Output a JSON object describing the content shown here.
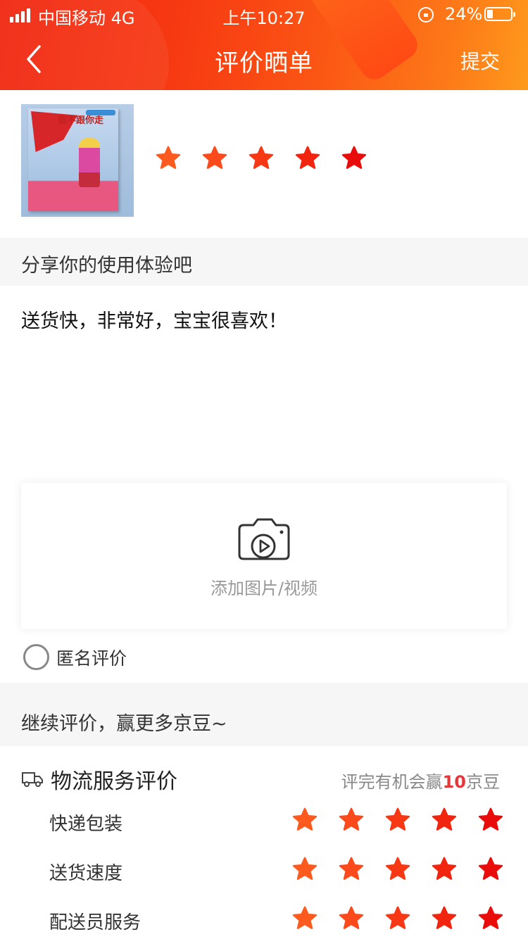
{
  "status_bar": {
    "carrier": "中国移动  4G",
    "time": "上午10:27",
    "battery": "24%",
    "battery_level": 0.24
  },
  "nav": {
    "title": "评价晒单",
    "submit_label": "提交",
    "back_icon": "chevron-left-icon"
  },
  "product": {
    "cover_text": "我不跟你走",
    "rating": 5
  },
  "share_section": {
    "label": "分享你的使用体验吧"
  },
  "review": {
    "text": "送货快，非常好，宝宝很喜欢！"
  },
  "upload": {
    "label": "添加图片/视频",
    "icon": "camera-video-icon"
  },
  "anonymous": {
    "label": "匿名评价",
    "checked": false
  },
  "continue_section": {
    "label": "继续评价，赢更多京豆~"
  },
  "logistics": {
    "title": "物流服务评价",
    "bonus_prefix": "评完有机会赢",
    "bonus_num": "10",
    "bonus_suffix": "京豆",
    "rows": [
      {
        "label": "快递包装",
        "rating": 5
      },
      {
        "label": "送货速度",
        "rating": 5
      },
      {
        "label": "配送员服务",
        "rating": 5
      }
    ]
  },
  "colors": {
    "star_gradient": [
      "#fd5a1f",
      "#fb4a1b",
      "#f63815",
      "#f1250f",
      "#e80c0b"
    ],
    "brand_red": "#e4393c"
  }
}
